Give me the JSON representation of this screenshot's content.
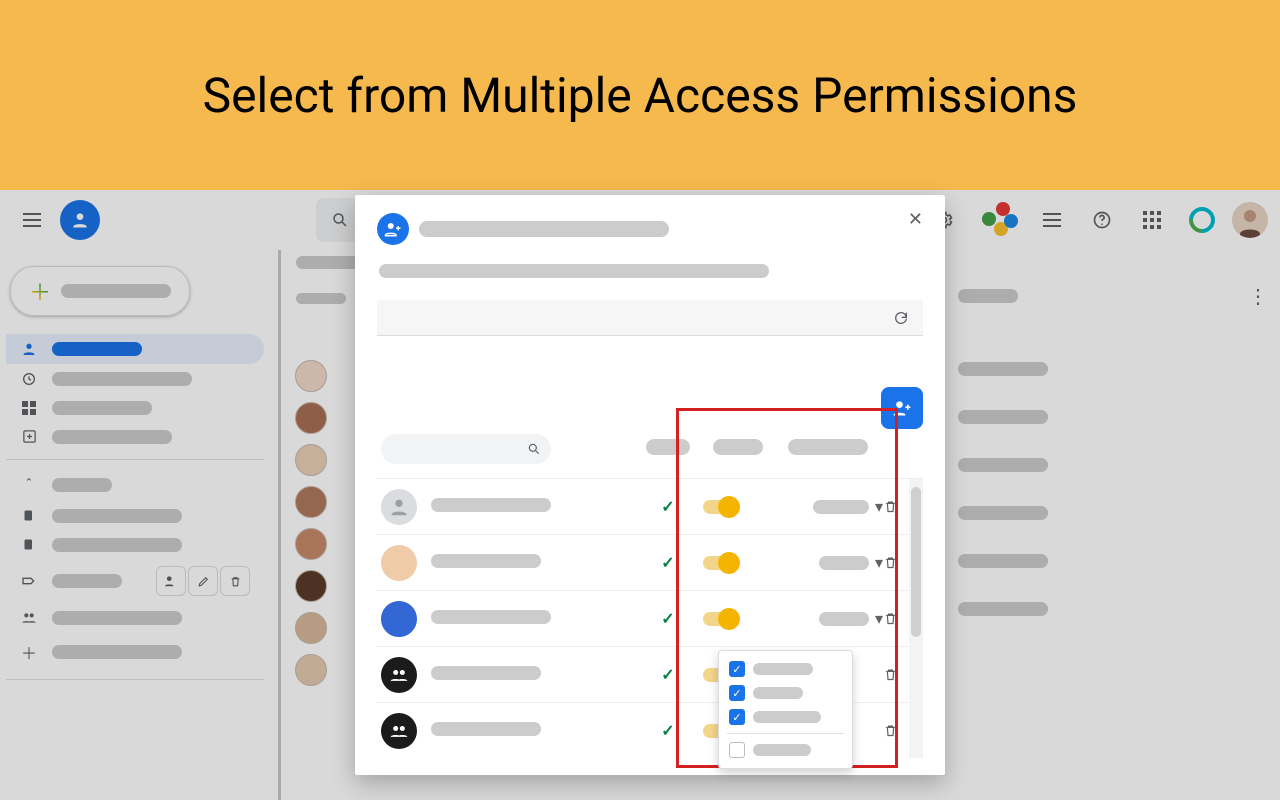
{
  "banner": {
    "title": "Select from Multiple Access Permissions"
  },
  "topbar": {
    "menu_icon": "menu",
    "app_icon": "person",
    "search_icon": "search",
    "settings_icon": "settings",
    "share_icon": "share",
    "list_icon": "list",
    "help_icon": "help",
    "apps_icon": "apps",
    "brand_icon": "brand"
  },
  "sidebar": {
    "create_label": "",
    "items": [
      {
        "icon": "person",
        "label": "",
        "selected": true
      },
      {
        "icon": "history",
        "label": ""
      },
      {
        "icon": "grid",
        "label": ""
      },
      {
        "icon": "plus-square",
        "label": ""
      }
    ],
    "labels_header": "",
    "labels": [
      {
        "icon": "label",
        "label": ""
      },
      {
        "icon": "label",
        "label": ""
      },
      {
        "icon": "tag",
        "label": "",
        "actions": true
      },
      {
        "icon": "group",
        "label": ""
      },
      {
        "icon": "plus",
        "label": ""
      }
    ]
  },
  "list_header": {
    "title": "",
    "sort": ""
  },
  "modal": {
    "title_label": "",
    "subtitle_label": "",
    "refresh_icon": "refresh",
    "add_delegate_icon": "person-add",
    "columns": {
      "name": "",
      "chk": "",
      "toggle": "",
      "role": ""
    },
    "rows": [
      {
        "name": "",
        "avatar": "generic",
        "checked": true,
        "role": ""
      },
      {
        "name": "",
        "avatar": "f1",
        "checked": true,
        "role": ""
      },
      {
        "name": "",
        "avatar": "f2",
        "checked": true,
        "role": ""
      },
      {
        "name": "",
        "avatar": "group",
        "checked": true,
        "role": ""
      },
      {
        "name": "",
        "avatar": "group",
        "checked": true,
        "role": ""
      }
    ]
  },
  "permissions_dropdown": {
    "options": [
      {
        "label": "",
        "checked": true
      },
      {
        "label": "",
        "checked": true
      },
      {
        "label": "",
        "checked": true
      },
      {
        "label": "",
        "checked": false
      }
    ]
  }
}
